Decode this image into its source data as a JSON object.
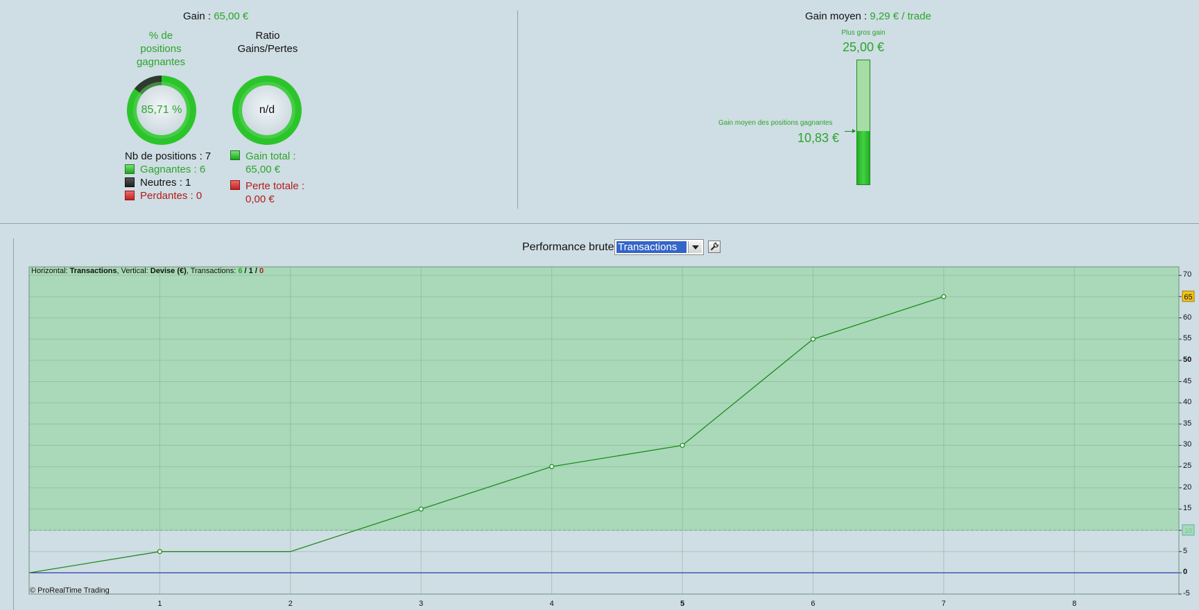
{
  "summary": {
    "gain_label": "Gain : ",
    "gain_value": "65,00 €",
    "pct_title": [
      "% de",
      "positions",
      "gagnantes"
    ],
    "pct_value": "85,71 %",
    "pct_fraction": 0.8571,
    "ratio_title": [
      "Ratio",
      "Gains/Pertes"
    ],
    "ratio_value": "n/d",
    "nb_positions": "Nb de positions : 7",
    "gagnantes": "Gagnantes : 6",
    "neutres": "Neutres : 1",
    "perdantes": "Perdantes : 0",
    "gain_total_label": "Gain total :",
    "gain_total_value": "65,00 €",
    "perte_totale_label": "Perte totale :",
    "perte_totale_value": "0,00 €"
  },
  "average": {
    "label": "Gain moyen : ",
    "value": "9,29 € / trade",
    "plus_gros_gain_label": "Plus gros gain",
    "plus_gros_gain_value": "25,00 €",
    "gain_moyen_positions_label": "Gain moyen des positions gagnantes",
    "gain_moyen_positions_value": "10,83 €",
    "bar_fill_fraction": 0.433
  },
  "chart_header": {
    "title": "Performance brute",
    "select_value": "Transactions"
  },
  "chart_info": {
    "h_label": "Horizontal: ",
    "h_value": "Transactions",
    "v_label": ", Vertical: ",
    "v_value": "Devise (€)",
    "t_label": ", Transactions: ",
    "t_win": "6",
    "sep1": " / ",
    "t_neutral": "1",
    "sep2": " / ",
    "t_loss": "0",
    "copyright": "© ProRealTime Trading"
  },
  "colors": {
    "background": "#cfdde4",
    "gain_green": "#2aa52a",
    "loss_red": "#b01c1c",
    "plot_fill": "#a9d9b8",
    "line": "#1f8a1f",
    "zero_line": "#2f3fb0",
    "marker_yellow": "#f4c21a"
  },
  "chart_data": {
    "type": "line",
    "title": "Performance brute",
    "x": [
      0,
      1,
      2,
      3,
      4,
      5,
      6,
      7
    ],
    "y": [
      0,
      5,
      5,
      15,
      25,
      30,
      55,
      65
    ],
    "points_marked": [
      1,
      3,
      4,
      5,
      6,
      7
    ],
    "xlim": [
      0,
      8.8
    ],
    "ylim": [
      -5,
      72
    ],
    "x_ticks": [
      "1",
      "2",
      "3",
      "4",
      "5",
      "6",
      "7",
      "8"
    ],
    "y_ticks": [
      "-5",
      "0",
      "5",
      "10",
      "15",
      "20",
      "25",
      "30",
      "35",
      "40",
      "45",
      "50",
      "55",
      "60",
      "65",
      "70"
    ],
    "highlight_above": 10,
    "last_value_label": "65",
    "threshold_label": "10",
    "grid": true
  }
}
